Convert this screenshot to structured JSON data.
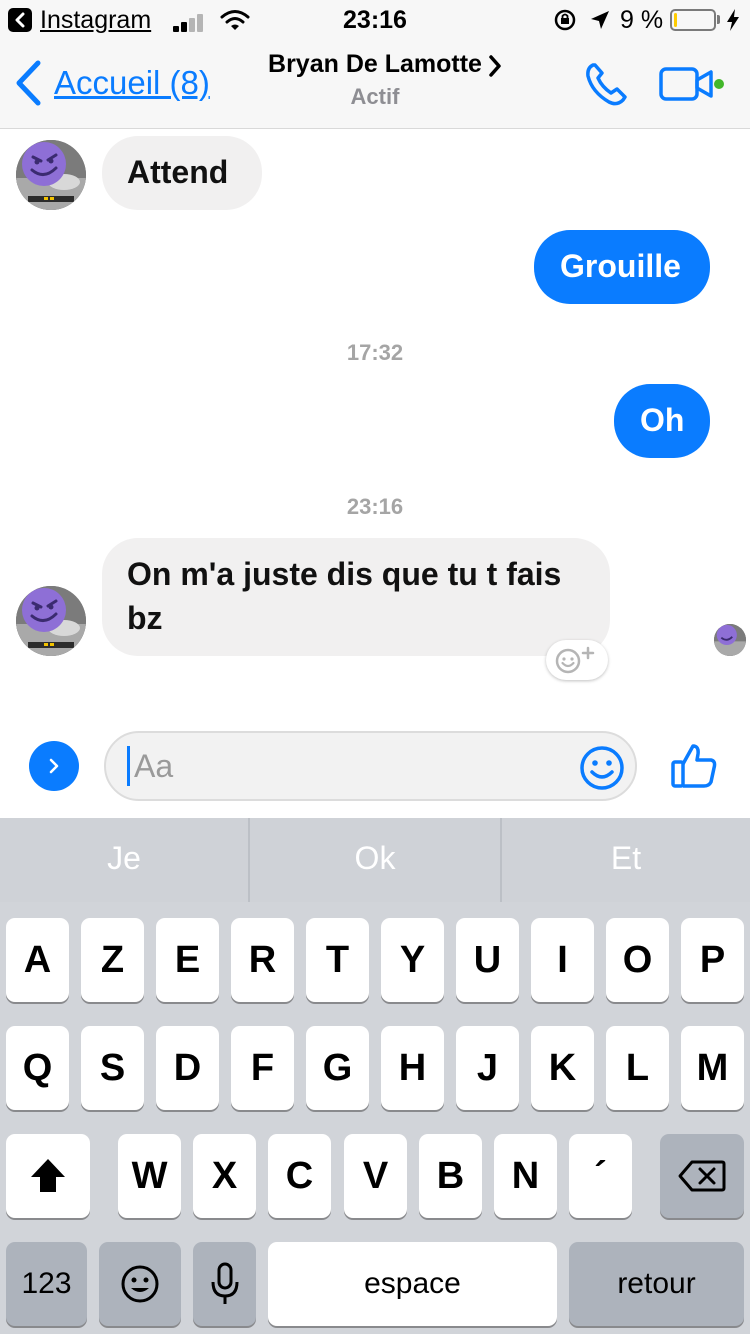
{
  "status_bar": {
    "back_app": "Instagram",
    "time": "23:16",
    "battery_percent": "9 %",
    "battery_level": 0.09,
    "icons": [
      "back-app-icon",
      "signal-icon",
      "wifi-icon",
      "rotation-lock-icon",
      "location-arrow-icon",
      "battery-icon",
      "charging-bolt-icon"
    ]
  },
  "nav": {
    "back_label": "Accueil (8)",
    "contact_name": "Bryan De Lamotte",
    "contact_status": "Actif",
    "icons": [
      "back-chevron-icon",
      "chevron-right-icon",
      "phone-icon",
      "video-camera-icon"
    ]
  },
  "conversation": {
    "messages": [
      {
        "direction": "in",
        "text": "Attend"
      },
      {
        "direction": "out",
        "text": "Grouille"
      },
      {
        "timestamp": "17:32"
      },
      {
        "direction": "out",
        "text": "Oh"
      },
      {
        "timestamp": "23:16"
      },
      {
        "direction": "in",
        "lines": [
          "On m'a juste dis que tu t fais",
          "bz"
        ]
      }
    ]
  },
  "composer": {
    "placeholder": "Aa",
    "icons": [
      "expand-chevron-icon",
      "emoji-icon",
      "thumbs-up-icon"
    ]
  },
  "keyboard": {
    "suggestions": [
      "Je",
      "Ok",
      "Et"
    ],
    "row1": [
      "A",
      "Z",
      "E",
      "R",
      "T",
      "Y",
      "U",
      "I",
      "O",
      "P"
    ],
    "row2": [
      "Q",
      "S",
      "D",
      "F",
      "G",
      "H",
      "J",
      "K",
      "L",
      "M"
    ],
    "row3": [
      "W",
      "X",
      "C",
      "V",
      "B",
      "N",
      "´"
    ],
    "numbers_key": "123",
    "space_key": "espace",
    "return_key": "retour",
    "icons": [
      "shift-icon",
      "backspace-icon",
      "emoji-keyboard-icon",
      "microphone-icon"
    ]
  },
  "colors": {
    "accent": "#0a7cff",
    "incoming_bubble": "#f1f0f0",
    "active_dot": "#42b72a",
    "battery_low": "#ffcc00"
  }
}
